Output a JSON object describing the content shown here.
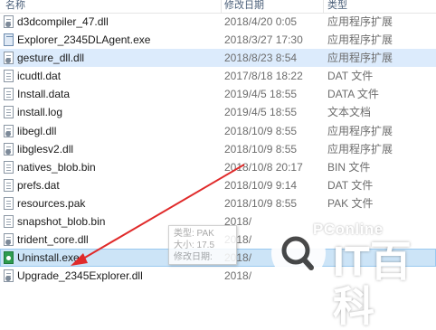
{
  "header": {
    "name": "名称",
    "date": "修改日期",
    "type": "类型"
  },
  "files": [
    {
      "name": "d3dcompiler_47.dll",
      "date": "2018/4/20 0:05",
      "type": "应用程序扩展",
      "icon": "dll-file-icon"
    },
    {
      "name": "Explorer_2345DLAgent.exe",
      "date": "2018/3/27 17:30",
      "type": "应用程序扩展",
      "icon": "exe-file-icon"
    },
    {
      "name": "gesture_dll.dll",
      "date": "2018/8/23 8:54",
      "type": "应用程序扩展",
      "icon": "dll-file-icon"
    },
    {
      "name": "icudtl.dat",
      "date": "2017/8/18 18:22",
      "type": "DAT 文件",
      "icon": "dat-file-icon"
    },
    {
      "name": "Install.data",
      "date": "2019/4/5 18:55",
      "type": "DATA 文件",
      "icon": "data-file-icon"
    },
    {
      "name": "install.log",
      "date": "2019/4/5 18:55",
      "type": "文本文档",
      "icon": "log-file-icon"
    },
    {
      "name": "libegl.dll",
      "date": "2018/10/9 8:55",
      "type": "应用程序扩展",
      "icon": "dll-file-icon"
    },
    {
      "name": "libglesv2.dll",
      "date": "2018/10/9 8:55",
      "type": "应用程序扩展",
      "icon": "dll-file-icon"
    },
    {
      "name": "natives_blob.bin",
      "date": "2018/10/8 20:17",
      "type": "BIN 文件",
      "icon": "bin-file-icon"
    },
    {
      "name": "prefs.dat",
      "date": "2018/10/9 9:14",
      "type": "DAT 文件",
      "icon": "dat-file-icon"
    },
    {
      "name": "resources.pak",
      "date": "2018/10/9 8:55",
      "type": "PAK 文件",
      "icon": "pak-file-icon"
    },
    {
      "name": "snapshot_blob.bin",
      "date": "2018/",
      "type": "",
      "icon": "bin-file-icon"
    },
    {
      "name": "trident_core.dll",
      "date": "2018/",
      "type": "",
      "icon": "dll-file-icon"
    },
    {
      "name": "Uninstall.exe",
      "date": "2018/",
      "type": "",
      "icon": "uninstall-exe-icon"
    },
    {
      "name": "Upgrade_2345Explorer.dll",
      "date": "2018/",
      "type": "",
      "icon": "dll-file-icon"
    }
  ],
  "tooltip": {
    "line1": "类型: PAK",
    "line2": "大小: 17.5",
    "line3": "修改日期:"
  },
  "watermark": {
    "small": "PConline",
    "brand": "IT百科"
  },
  "colors": {
    "hover_row": "#dcebfc",
    "selected_row": "#cce4f7",
    "arrow": "#e02a2a"
  }
}
